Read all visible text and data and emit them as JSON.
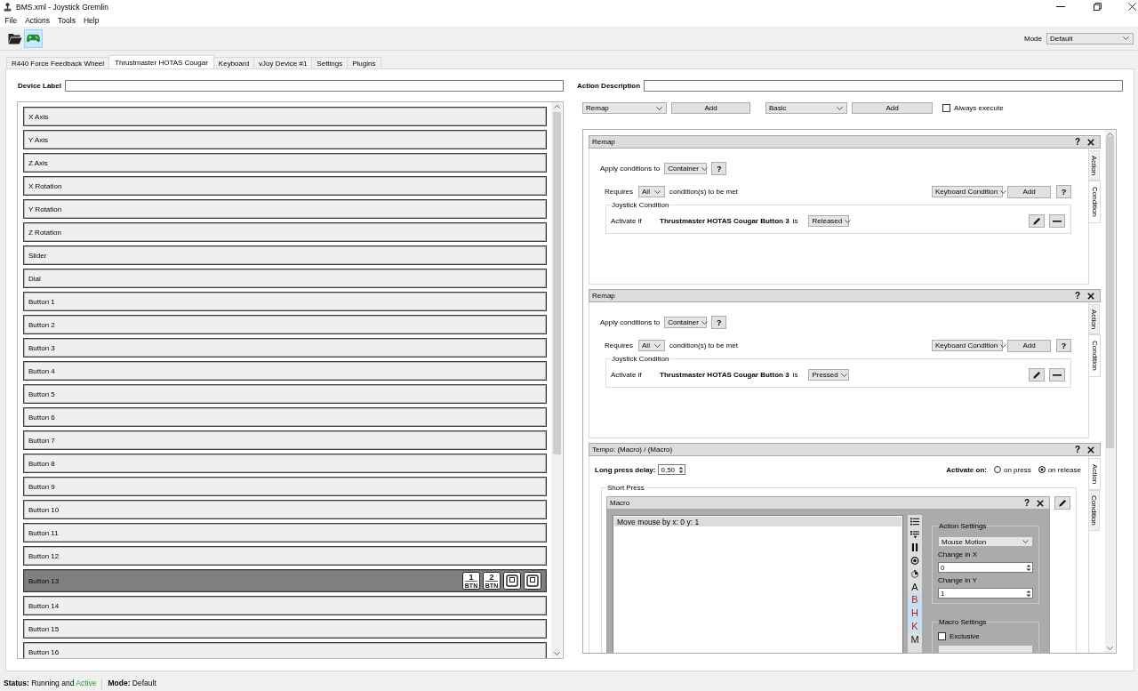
{
  "window": {
    "title": "BMS.xml - Joystick Gremlin"
  },
  "menu": [
    {
      "label": "File"
    },
    {
      "label": "Actions"
    },
    {
      "label": "Tools"
    },
    {
      "label": "Help"
    }
  ],
  "toolbar": [
    {
      "kind": "open",
      "selected": false
    },
    {
      "kind": "gamepad",
      "selected": true
    }
  ],
  "mode": {
    "label": "Mode",
    "value": "Default"
  },
  "tabs": [
    {
      "label": "R440 Force Feedback Wheel",
      "selected": false
    },
    {
      "label": "Thrustmaster HOTAS Cougar",
      "selected": true
    },
    {
      "label": "Keyboard",
      "selected": false
    },
    {
      "label": "vJoy Device #1",
      "selected": false
    },
    {
      "label": "Settings",
      "selected": false
    },
    {
      "label": "Plugins",
      "selected": false
    }
  ],
  "device_label": {
    "label": "Device Label"
  },
  "inputs": [
    {
      "label": "X Axis",
      "selected": false
    },
    {
      "label": "Y Axis",
      "selected": false
    },
    {
      "label": "Z Axis",
      "selected": false
    },
    {
      "label": "X Rotation",
      "selected": false
    },
    {
      "label": "Y Rotation",
      "selected": false
    },
    {
      "label": "Z Rotation",
      "selected": false
    },
    {
      "label": "Slider",
      "selected": false
    },
    {
      "label": "Dial",
      "selected": false
    },
    {
      "label": "Button 1",
      "selected": false
    },
    {
      "label": "Button 2",
      "selected": false
    },
    {
      "label": "Button 3",
      "selected": false
    },
    {
      "label": "Button 4",
      "selected": false
    },
    {
      "label": "Button 5",
      "selected": false
    },
    {
      "label": "Button 6",
      "selected": false
    },
    {
      "label": "Button 7",
      "selected": false
    },
    {
      "label": "Button 8",
      "selected": false
    },
    {
      "label": "Button 9",
      "selected": false
    },
    {
      "label": "Button 10",
      "selected": false
    },
    {
      "label": "Button 11",
      "selected": false
    },
    {
      "label": "Button 12",
      "selected": false
    },
    {
      "label": "Button 13",
      "selected": true,
      "actions": [
        {
          "kind": "button",
          "number": "1",
          "caption": "BTN"
        },
        {
          "kind": "button",
          "number": "2",
          "caption": "BTN"
        },
        {
          "kind": "framed"
        },
        {
          "kind": "framed"
        }
      ]
    },
    {
      "label": "Button 14",
      "selected": false
    },
    {
      "label": "Button 15",
      "selected": false
    },
    {
      "label": "Button 16",
      "selected": false
    }
  ],
  "action_description": {
    "label": "Action Description"
  },
  "action_bar": {
    "action_type": "Remap",
    "add_action": "Add",
    "container_type": "Basic",
    "add_container": "Add",
    "always_execute": {
      "label": "Always execute",
      "checked": false
    }
  },
  "containers": [
    {
      "kind": "remap",
      "title": "Remap",
      "help": "?",
      "side_tabs": [
        {
          "label": "Action",
          "selected": false
        },
        {
          "label": "Condition",
          "selected": true
        }
      ],
      "apply": {
        "label": "Apply conditions to",
        "value": "Container",
        "help": "?"
      },
      "requires": {
        "label": "Requires",
        "value": "All",
        "suffix": "condition(s) to be met",
        "type": "Keyboard Condition",
        "add": "Add",
        "help": "?"
      },
      "condition": {
        "title": "Joystick Condition",
        "label": "Activate if",
        "input": "Thrustmaster HOTAS Cougar Button 3",
        "is": "is",
        "state": "Released"
      }
    },
    {
      "kind": "remap",
      "title": "Remap",
      "help": "?",
      "side_tabs": [
        {
          "label": "Action",
          "selected": false
        },
        {
          "label": "Condition",
          "selected": true
        }
      ],
      "apply": {
        "label": "Apply conditions to",
        "value": "Container",
        "help": "?"
      },
      "requires": {
        "label": "Requires",
        "value": "All",
        "suffix": "condition(s) to be met",
        "type": "Keyboard Condition",
        "add": "Add",
        "help": "?"
      },
      "condition": {
        "title": "Joystick Condition",
        "label": "Activate if",
        "input": "Thrustmaster HOTAS Cougar Button 3",
        "is": "is",
        "state": "Pressed"
      }
    },
    {
      "kind": "tempo",
      "title": "Tempo: (Macro) / (Macro)",
      "help": "?",
      "side_tabs": [
        {
          "label": "Action",
          "selected": true
        },
        {
          "label": "Condition",
          "selected": false
        }
      ],
      "delay": {
        "label": "Long press delay:",
        "value": "0,50"
      },
      "activate": {
        "label": "Activate on:",
        "options": [
          {
            "label": "on press",
            "selected": false
          },
          {
            "label": "on release",
            "selected": true
          }
        ]
      },
      "group": "Short Press",
      "macro": {
        "title": "Macro",
        "help": "?",
        "entries": [
          {
            "label": "Move mouse by x: 0 y: 1",
            "selected": true
          }
        ],
        "tools": [
          {
            "kind": "list",
            "on": false
          },
          {
            "kind": "insert",
            "on": false
          },
          {
            "kind": "pause",
            "on": false
          },
          {
            "kind": "record",
            "on": false
          },
          {
            "kind": "timer",
            "on": false
          },
          {
            "kind": "letter",
            "label": "A",
            "on": false
          },
          {
            "kind": "letter",
            "label": "B",
            "on": true
          },
          {
            "kind": "letter",
            "label": "H",
            "on": true
          },
          {
            "kind": "letter",
            "label": "K",
            "on": true
          },
          {
            "kind": "letter",
            "label": "M",
            "on": false
          }
        ],
        "action_settings": {
          "title": "Action Settings",
          "type": "Mouse Motion",
          "fields": [
            {
              "label": "Change in X",
              "value": "0"
            },
            {
              "label": "Change in Y",
              "value": "1"
            }
          ]
        },
        "macro_settings": {
          "title": "Macro Settings",
          "exclusive": {
            "label": "Exclusive",
            "checked": false
          }
        }
      }
    }
  ],
  "status_bar": {
    "status": {
      "label": "Status:",
      "text": "Running and",
      "state": "Active",
      "active": true
    },
    "mode": {
      "label": "Mode:",
      "value": "Default"
    }
  }
}
